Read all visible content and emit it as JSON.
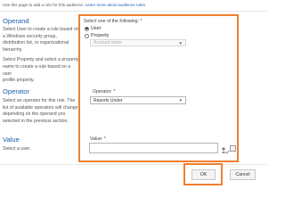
{
  "intro": {
    "text": "Use this page to add a rule for this audience.",
    "link": "Learn more about audience rules."
  },
  "operand": {
    "title": "Operand",
    "desc_lines": [
      "Select User to create a rule based on",
      "a Windows security group,",
      "distribution list, or organizational",
      "hierarchy.",
      "",
      "Select Property and select a property",
      "name to create a rule based on a user",
      "profile property."
    ]
  },
  "operator": {
    "title": "Operator",
    "desc_lines": [
      "Select an operator for this rule. The",
      "list of available operators will change",
      "depending on the operand you",
      "selected in the previous section."
    ]
  },
  "value": {
    "title": "Value",
    "desc_lines": [
      "Select a user."
    ]
  },
  "form": {
    "operand_label": "Select one of the following: *",
    "user_option": "User",
    "property_option": "Property",
    "property_select": "Account name",
    "operator_label": "Operator: *",
    "operator_select": "Reports Under",
    "value_label": "Value: *"
  },
  "buttons": {
    "ok": "OK",
    "cancel": "Cancel"
  },
  "colors": {
    "highlight": "#f07f2e",
    "section_title": "#1f5fa8",
    "link": "#1e5fb4"
  }
}
